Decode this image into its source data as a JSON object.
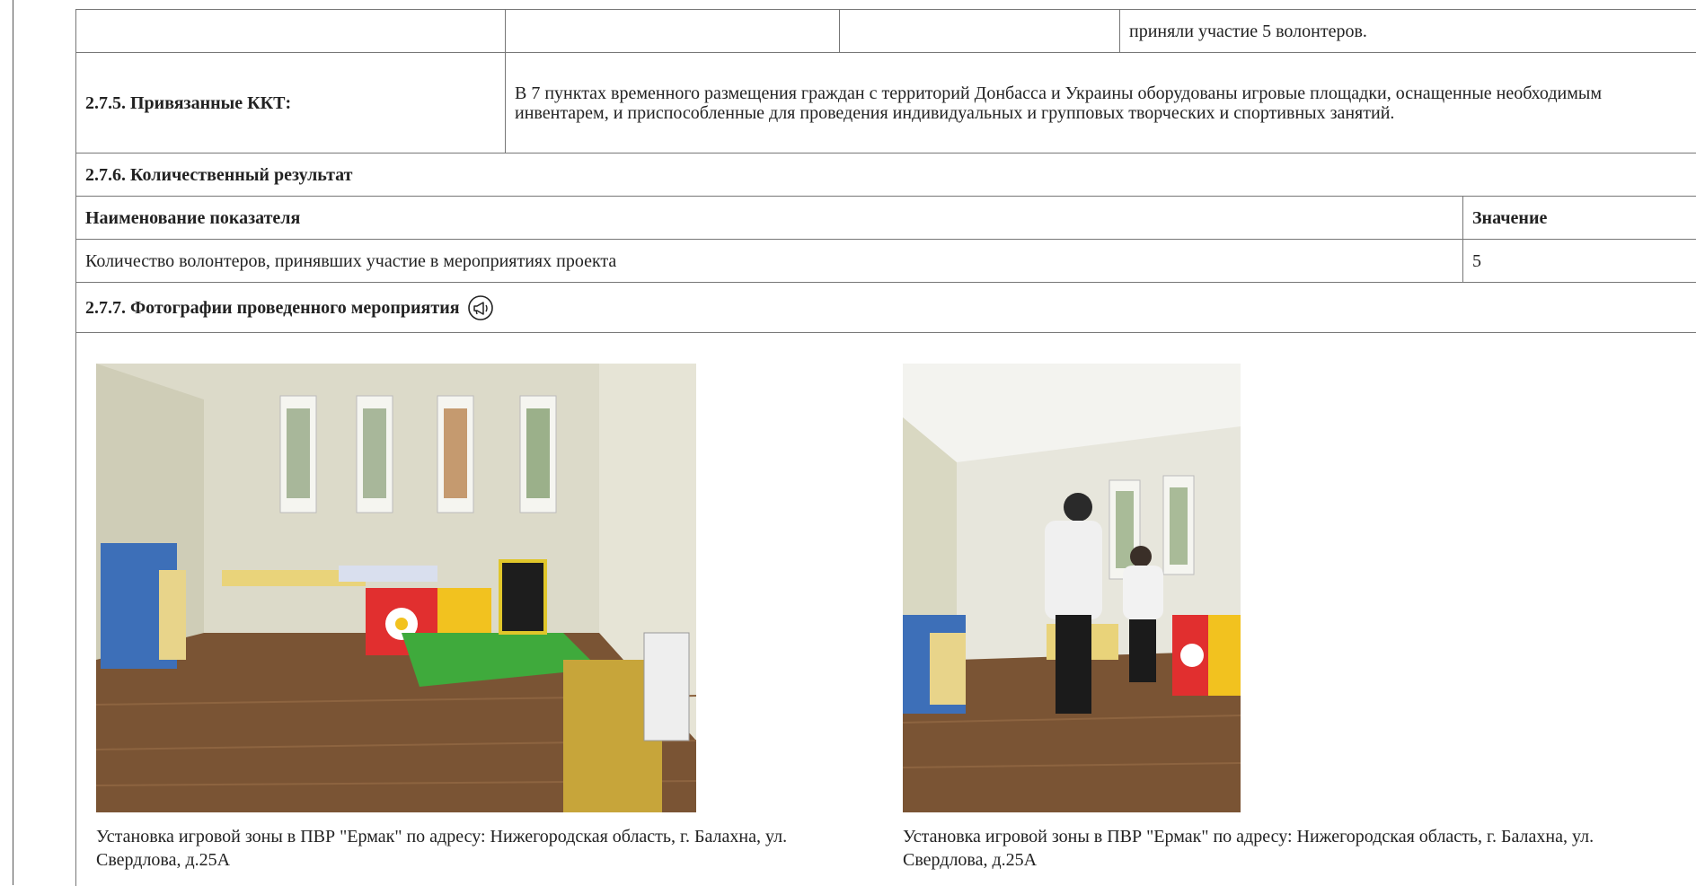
{
  "row_top": {
    "right_text": "приняли участие 5 волонтеров."
  },
  "kkt": {
    "label": "2.7.5. Привязанные ККТ:",
    "text": "В 7 пунктах временного размещения граждан с территорий Донбасса и Украины оборудованы игровые площадки, оснащенные необходимым инвентарем, и приспособленные для проведения индивидуальных и групповых творческих и спортивных занятий."
  },
  "quant": {
    "heading": "2.7.6. Количественный результат",
    "col_name": "Наименование показателя",
    "col_value": "Значение",
    "rows": [
      {
        "name": "Количество волонтеров, принявших участие в мероприятиях проекта",
        "value": "5"
      }
    ]
  },
  "photos": {
    "heading": "2.7.7. Фотографии проведенного мероприятия",
    "heading_icon": "megaphone-icon",
    "items": [
      {
        "caption": "Установка игровой зоны в ПВР \"Ермак\" по адресу: Нижегородская область, г. Балахна, ул. Свердлова, д.25А"
      },
      {
        "caption": "Установка игровой зоны в ПВР \"Ермак\" по адресу: Нижегородская область, г. Балахна, ул. Свердлова, д.25А"
      }
    ]
  },
  "colors": {
    "border": "#777777",
    "text": "#222222",
    "floor": "#7a5434",
    "wall": "#d9d6c4"
  }
}
